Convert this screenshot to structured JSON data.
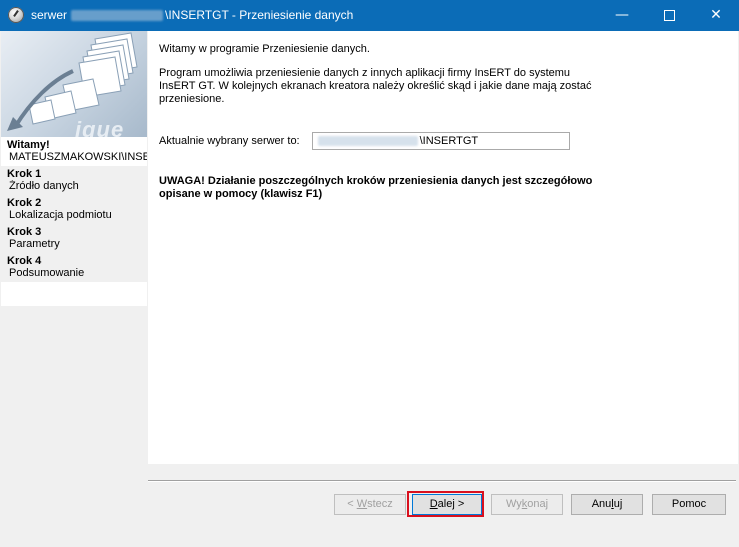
{
  "window": {
    "title_prefix": "serwer",
    "title_suffix": "\\INSERTGT - Przeniesienie danych",
    "icon": "app-globe-icon",
    "controls": [
      "minimize-icon",
      "maximize-icon",
      "close-icon"
    ]
  },
  "sidebar": {
    "banner_text": "ique",
    "steps": [
      {
        "title": "Witamy!",
        "subtitle": "MATEUSZMAKOWSKI\\INSE",
        "active": true
      },
      {
        "title": "Krok 1",
        "subtitle": "Źródło danych",
        "active": false
      },
      {
        "title": "Krok 2",
        "subtitle": "Lokalizacja podmiotu",
        "active": false
      },
      {
        "title": "Krok 3",
        "subtitle": "Parametry",
        "active": false
      },
      {
        "title": "Krok 4",
        "subtitle": "Podsumowanie",
        "active": false
      }
    ]
  },
  "content": {
    "welcome": "Witamy w programie Przeniesienie danych.",
    "description_lines": [
      "Program umożliwia przeniesienie danych z innych aplikacji firmy InsERT do systemu",
      "InsERT GT. W kolejnych ekranach kreatora należy określić skąd i jakie dane mają zostać",
      "przeniesione."
    ],
    "server_label": "Aktualnie wybrany serwer to:",
    "server_value_suffix": "\\INSERTGT",
    "warning_lines": [
      "UWAGA! Działanie poszczególnych kroków przeniesienia danych jest szczegółowo",
      "opisane w pomocy (klawisz F1)"
    ]
  },
  "buttons": {
    "back": {
      "prefix": "< ",
      "mnemonic": "W",
      "rest": "stecz",
      "enabled": false
    },
    "next": {
      "mnemonic": "D",
      "rest": "alej >",
      "enabled": true,
      "highlighted": true
    },
    "run": {
      "prefix": "Wy",
      "mnemonic": "k",
      "rest": "onaj",
      "enabled": false
    },
    "cancel": {
      "prefix": "Anu",
      "mnemonic": "l",
      "rest": "uj",
      "enabled": true
    },
    "help": {
      "label": "Pomoc",
      "enabled": true
    }
  },
  "colors": {
    "titlebar": "#0b6cb7",
    "highlight": "#d9101e"
  }
}
